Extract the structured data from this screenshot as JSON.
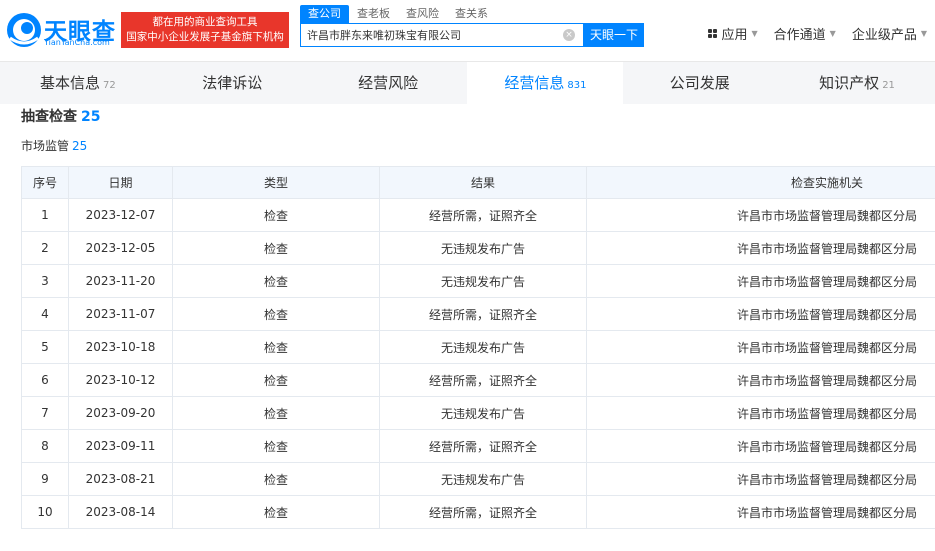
{
  "header": {
    "logo_text": "天眼查",
    "logo_sub": "TianYanCha.com",
    "promo_line1": "都在用的商业查询工具",
    "promo_line2": "国家中小企业发展子基金旗下机构",
    "search_tabs": [
      "查公司",
      "查老板",
      "查风险",
      "查关系"
    ],
    "search_value": "许昌市胖东来唯初珠宝有限公司",
    "clear_symbol": "×",
    "search_button": "天眼一下",
    "nav": [
      "应用",
      "合作通道",
      "企业级产品"
    ],
    "caret": "▼"
  },
  "tabs": [
    {
      "label": "基本信息",
      "count": "72"
    },
    {
      "label": "法律诉讼",
      "count": ""
    },
    {
      "label": "经营风险",
      "count": ""
    },
    {
      "label": "经营信息",
      "count": "831"
    },
    {
      "label": "公司发展",
      "count": ""
    },
    {
      "label": "知识产权",
      "count": "21"
    }
  ],
  "section": {
    "title": "抽查检查",
    "count": "25",
    "sub_title": "市场监管",
    "sub_count": "25"
  },
  "table": {
    "headers": [
      "序号",
      "日期",
      "类型",
      "结果",
      "检查实施机关"
    ],
    "rows": [
      [
        "1",
        "2023-12-07",
        "检查",
        "经营所需，证照齐全",
        "许昌市市场监督管理局魏都区分局"
      ],
      [
        "2",
        "2023-12-05",
        "检查",
        "无违规发布广告",
        "许昌市市场监督管理局魏都区分局"
      ],
      [
        "3",
        "2023-11-20",
        "检查",
        "无违规发布广告",
        "许昌市市场监督管理局魏都区分局"
      ],
      [
        "4",
        "2023-11-07",
        "检查",
        "经营所需，证照齐全",
        "许昌市市场监督管理局魏都区分局"
      ],
      [
        "5",
        "2023-10-18",
        "检查",
        "无违规发布广告",
        "许昌市市场监督管理局魏都区分局"
      ],
      [
        "6",
        "2023-10-12",
        "检查",
        "经营所需，证照齐全",
        "许昌市市场监督管理局魏都区分局"
      ],
      [
        "7",
        "2023-09-20",
        "检查",
        "无违规发布广告",
        "许昌市市场监督管理局魏都区分局"
      ],
      [
        "8",
        "2023-09-11",
        "检查",
        "经营所需，证照齐全",
        "许昌市市场监督管理局魏都区分局"
      ],
      [
        "9",
        "2023-08-21",
        "检查",
        "无违规发布广告",
        "许昌市市场监督管理局魏都区分局"
      ],
      [
        "10",
        "2023-08-14",
        "检查",
        "经营所需，证照齐全",
        "许昌市市场监督管理局魏都区分局"
      ]
    ]
  },
  "colors": {
    "brand": "#0084ff",
    "promo_bg": "#e8362b",
    "header_row_bg": "#f2f7fd",
    "tabbar_bg": "#f5f6f8"
  }
}
